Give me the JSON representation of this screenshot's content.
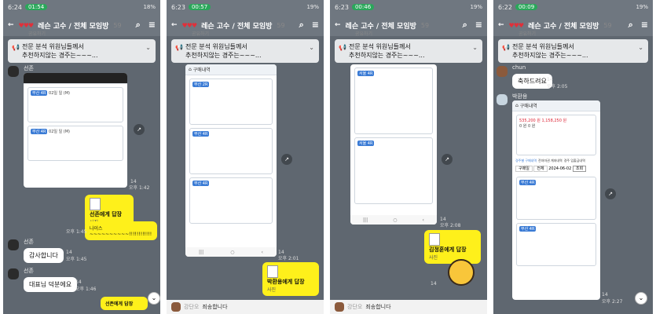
{
  "panels": [
    {
      "status_time": "6:24",
      "status_pill": "01:54",
      "status_right": "18%",
      "title": "레슨 고수 / 전체 모임방",
      "count": "59",
      "sub": "공유하기",
      "notice_line1": "전문 분석 위원님들께서",
      "notice_line2": "추천하지않는 경주는~~~...",
      "sender1": "선존",
      "bubble_file_title": "선존에게 답장",
      "bubble_file_sub": "사진",
      "bubble_text": "나이스~~~~~~~~~~!!!!!!!!!!!!",
      "bubble_num": "14",
      "time1": "오후 1:42",
      "time2": "오후 1:45",
      "sender2": "선존",
      "reply1": "감사합니다",
      "reply1_num": "14",
      "reply1_time": "오후 1:45",
      "sender3": "선존",
      "reply2": "대표님 덕분에요",
      "reply2_num": "14",
      "reply2_time": "오후 1:46",
      "bottom_bubble": "선존에게 답장",
      "card_tag": "부산 4R",
      "card_date": "02일 일 (M)"
    },
    {
      "status_time": "6:23",
      "status_pill": "00:57",
      "status_right": "19%",
      "title": "레슨 고수 / 전체 모임방",
      "count": "59",
      "sub": "공유하기",
      "notice_line1": "전문 분석 위원님들께서",
      "notice_line2": "추천하지않는 경주는~~~...",
      "card_tags": [
        "부산 2R",
        "부산 4R"
      ],
      "shot_title": "구매내역",
      "bubble_file_title": "박환용에게 답장",
      "bubble_file_sub": "사진",
      "num": "14",
      "time": "오후 2:01",
      "input_name": "강단오",
      "input_text": "죄송합니다"
    },
    {
      "status_time": "6:23",
      "status_pill": "00:46",
      "status_right": "19%",
      "title": "레슨 고수 / 전체 모임방",
      "count": "59",
      "sub": "공유하기",
      "notice_line1": "전문 분석 위원님들께서",
      "notice_line2": "추천하지않는 경주는~~~...",
      "card_tags": [
        "서울 4R",
        "서울 4R"
      ],
      "bubble_file_title": "김정훈에게 답장",
      "bubble_file_sub": "사진",
      "num": "14",
      "time": "오후 2:08",
      "input_name": "강단오",
      "input_text": "죄송합니다"
    },
    {
      "status_time": "6:22",
      "status_pill": "00:09",
      "status_right": "19%",
      "title": "레슨 고수 / 전체 모임방",
      "count": "59",
      "sub": "공유하기",
      "notice_line1": "전문 분석 위원님들께서",
      "notice_line2": "추천하지않는 경주는~~~...",
      "sender1": "chun",
      "reply1": "축하드려요",
      "reply1_num": "14",
      "reply1_time": "오후 2:05",
      "sender2": "박환용",
      "shot_title": "구매내역",
      "tabs": [
        "경주별 구매내역",
        "전자마권 계좌내역",
        "경주 입출금내역"
      ],
      "select1": "구매일",
      "select2": "전체",
      "btn": "조회",
      "date": "2024-06-02",
      "card_tags": [
        "부산 4R",
        "부산 4R"
      ],
      "num": "14",
      "time": "오후 2:27",
      "stats": [
        "535,200 원",
        "1,158,250 원",
        "0 원",
        "0 원"
      ]
    }
  ]
}
